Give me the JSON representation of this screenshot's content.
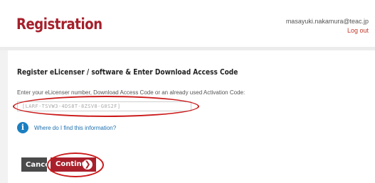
{
  "header": {
    "title": "Registration",
    "user_email": "masayuki.nakamura@teac.jp",
    "logout_label": "Log out"
  },
  "main": {
    "section_heading": "Register eLicenser / software & Enter Download Access Code",
    "instructions": "Enter your eLicenser number, Download Access Code or an already used Activation Code:",
    "code_value": "[LARF-TSVW3-4DS8T-8ZSV8-G0S2F]",
    "help_link": "Where do I find this information?",
    "cancel_label": "Cancel",
    "continue_label": "Continue"
  },
  "icons": {
    "info": "info-icon",
    "continue": "chevron-right-icon"
  },
  "colors": {
    "brand": "#a51f2b",
    "link": "#1b6fae",
    "annotation": "#cc1a1a"
  }
}
